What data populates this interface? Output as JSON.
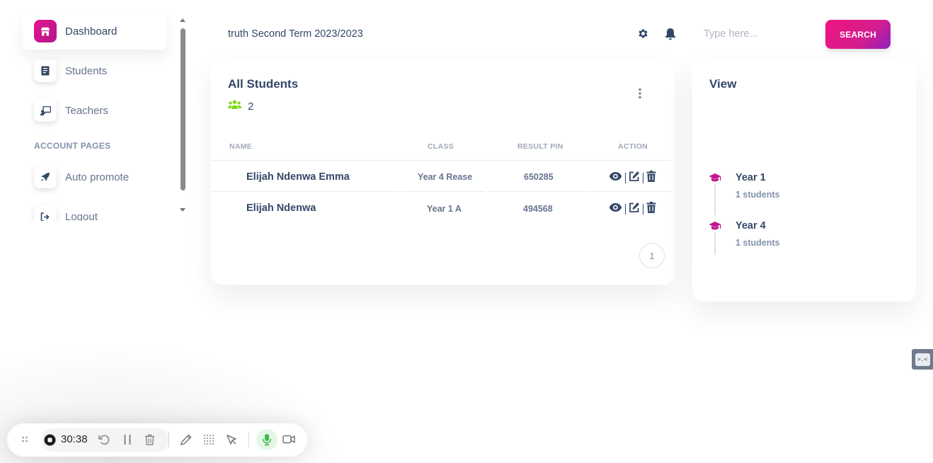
{
  "sidebar": {
    "items": [
      {
        "label": "Dashboard",
        "icon": "store-icon",
        "active": true
      },
      {
        "label": "Students",
        "icon": "document-icon"
      },
      {
        "label": "Teachers",
        "icon": "teacher-board-icon"
      }
    ],
    "section_title": "ACCOUNT PAGES",
    "account_items": [
      {
        "label": "Auto promote",
        "icon": "rocket-icon"
      },
      {
        "label": "Logout",
        "icon": "logout-icon"
      }
    ]
  },
  "header": {
    "term": "truth Second Term 2023/2023",
    "search_placeholder": "Type here...",
    "search_button": "SEARCH"
  },
  "students_card": {
    "title": "All Students",
    "count": "2",
    "columns": [
      "NAME",
      "CLASS",
      "RESULT PIN",
      "ACTION"
    ],
    "rows": [
      {
        "name": "Elijah Ndenwa Emma",
        "class": "Year 4 Rease",
        "pin": "650285"
      },
      {
        "name": "Elijah Ndenwa",
        "class": "Year 1 A",
        "pin": "494568"
      }
    ],
    "page": "1"
  },
  "view_card": {
    "title": "View",
    "classes": [
      {
        "name": "Year 1",
        "count": "1 students"
      },
      {
        "name": "Year 4",
        "count": "1 students"
      }
    ]
  },
  "recorder": {
    "timer": "30:38"
  },
  "colors": {
    "accent": "#e5138f",
    "accent_purple": "#8f21bf",
    "heading": "#344767",
    "muted": "#8392ab",
    "group_green": "#82d616",
    "mic_green": "#3fb950"
  }
}
